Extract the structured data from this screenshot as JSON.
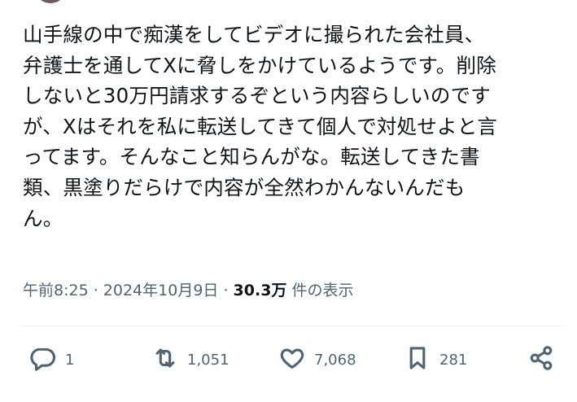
{
  "tweet": {
    "lines": [
      "山手線の中で痴漢をしてビデオに撮られた会社員、",
      "弁護士を通してXに脅しをかけているようです。削除",
      "しないと30万円請求するぞという内容らしいのです",
      "が、Xはそれを私に転送してきて個人で対処せよと言",
      "ってます。そんなこと知らんがな。転送してきた書",
      "類、黒塗りだらけで内容が全然わかんないんだも",
      "ん。"
    ]
  },
  "meta": {
    "timestamp": "午前8:25 · 2024年10月9日 · ",
    "views": "30.3万",
    "views_suffix": " 件の表示"
  },
  "actions": {
    "replies": "1",
    "reposts": "1,051",
    "likes": "7,068",
    "bookmarks": "281"
  },
  "colors": {
    "text": "#0f1419",
    "secondary": "#536471",
    "divider": "#eff3f4"
  },
  "icons": [
    "reply-icon",
    "repost-icon",
    "like-icon",
    "bookmark-icon",
    "share-icon"
  ]
}
